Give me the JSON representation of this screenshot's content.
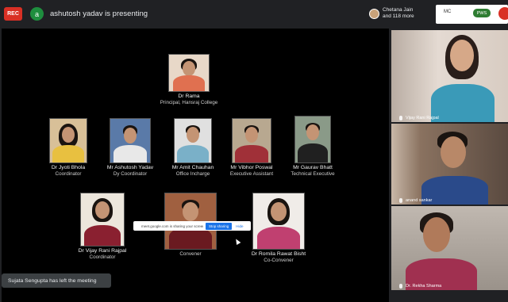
{
  "topbar": {
    "rec_label": "REC",
    "presenter_initial": "a",
    "presenting_text": "ashutosh yadav is presenting",
    "participants_line1": "Chetana Jain",
    "participants_line2": "and 118 more",
    "logo_text": "MC",
    "logo_badge": "PWS"
  },
  "slide": {
    "principal": {
      "name": "Dr Rama",
      "role": "Principal, Hansraj College"
    },
    "row2": [
      {
        "name": "Dr Jyoti Bhola",
        "role": "Coordinator"
      },
      {
        "name": "Mr Ashutosh Yadav",
        "role": "Dy Coordinator"
      },
      {
        "name": "Mr Amit Chauhan",
        "role": "Office Incharge"
      },
      {
        "name": "Mr Vibhor Poswal",
        "role": "Executive Assistant"
      },
      {
        "name": "Mr Gaurav Bhatt",
        "role": "Technical Executive"
      }
    ],
    "row3": [
      {
        "name": "Dr Vijay Rani Rajpal",
        "role": "Coordinator"
      },
      {
        "name": "",
        "role": "Convener"
      },
      {
        "name": "Dr Romila Rawat Bisht",
        "role": "Co-Convener"
      }
    ]
  },
  "share_bar": {
    "message": "meet.google.com is sharing your screen",
    "stop_label": "Stop sharing",
    "hide_label": "Hide"
  },
  "toast": {
    "text": "Sujata Sengupta has left the meeting"
  },
  "tiles": [
    {
      "name": "Vijay Rani Rajpal"
    },
    {
      "name": "anand sankar"
    },
    {
      "name": "Dr. Rekha Sharma"
    }
  ],
  "colors": {
    "rec": "#d93025",
    "accent": "#1a73e8",
    "background": "#202124"
  }
}
